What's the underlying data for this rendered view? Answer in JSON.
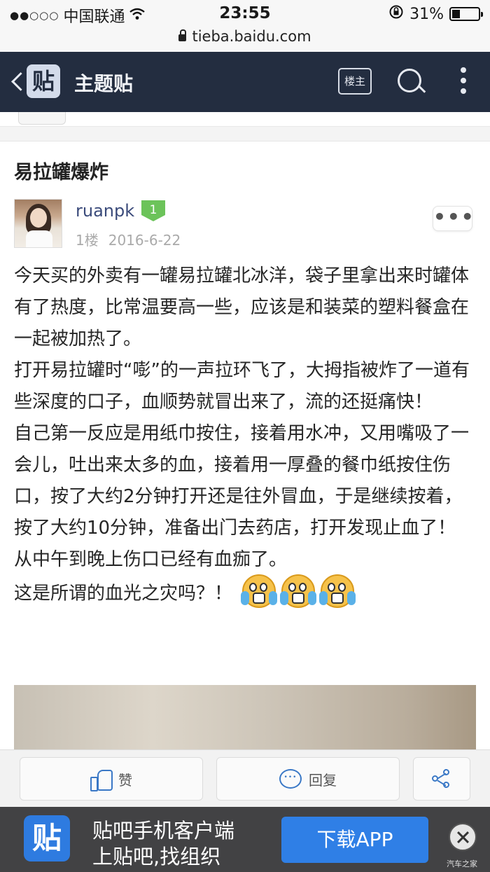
{
  "status_bar": {
    "signal": "●●○○○",
    "carrier": "中国联通",
    "time": "23:55",
    "battery": "31%",
    "battery_level": 0.31
  },
  "url_bar": {
    "url": "tieba.baidu.com"
  },
  "nav": {
    "logo_char": "贴",
    "title": "主题贴",
    "louzhu_label": "楼主"
  },
  "post": {
    "title": "易拉罐爆炸",
    "author": "ruanpk",
    "level": "1",
    "floor": "1楼",
    "date": "2016-6-22",
    "more": "•••",
    "lines": [
      "今天买的外卖有一罐易拉罐北冰洋，袋子里拿出来时罐体有了热度，比常温要高一些，应该是和装菜的塑料餐盒在一起被加热了。",
      "打开易拉罐时“嘭”的一声拉环飞了，大拇指被炸了一道有些深度的口子，血顺势就冒出来了，流的还挺痛快！",
      "自己第一反应是用纸巾按住，接着用水冲，又用嘴吸了一会儿，吐出来太多的血，接着用一厚叠的餐巾纸按住伤口，按了大约2分钟打开还是往外冒血，于是继续按着，按了大约10分钟，准备出门去药店，打开发现止血了！",
      "从中午到晚上伤口已经有血痂了。",
      "这是所谓的血光之灾吗？！"
    ]
  },
  "actions": {
    "like_label": "赞",
    "reply_label": "回复"
  },
  "app_banner": {
    "logo_char": "贴",
    "line1": "贴吧手机客户端",
    "line2": "上贴吧,找组织",
    "download_label": "下载APP",
    "watermark": "汽车之家"
  }
}
